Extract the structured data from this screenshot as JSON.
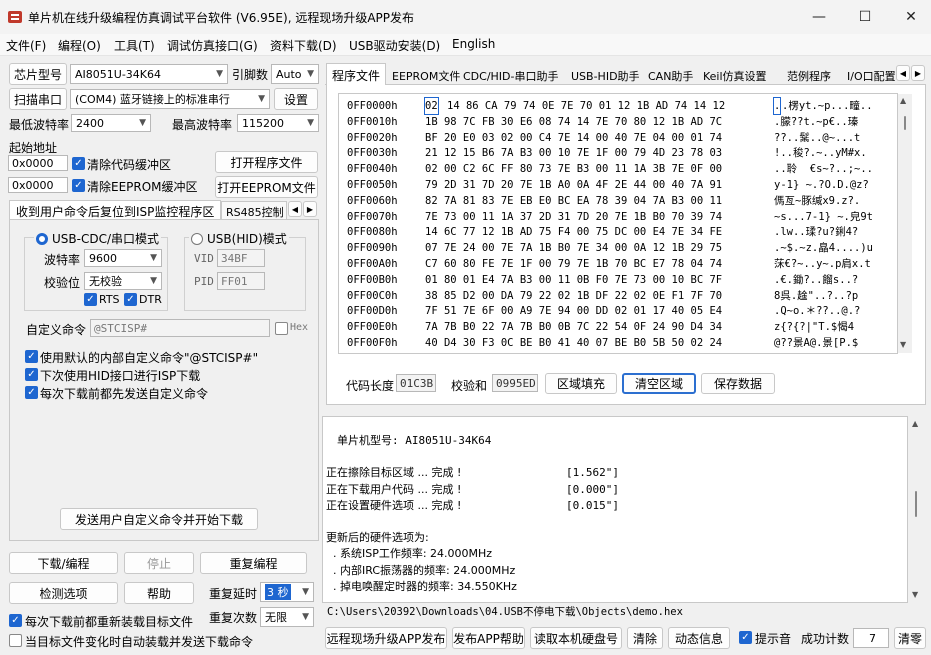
{
  "window": {
    "title": "单片机在线升级编程仿真调试平台软件 (V6.95E), 远程现场升级APP发布"
  },
  "menu": [
    "文件(F)",
    "编程(O)",
    "工具(T)",
    "调试仿真接口(G)",
    "资料下载(D)",
    "USB驱动安装(D)",
    "English"
  ],
  "left": {
    "chip_label": "芯片型号",
    "chip_value": "AI8051U-34K64",
    "pin_label": "引脚数",
    "pin_value": "Auto",
    "scan_button": "扫描串口",
    "port_value": "(COM4) 蓝牙链接上的标准串行",
    "settings_button": "设置",
    "min_baud_label": "最低波特率",
    "min_baud_value": "2400",
    "max_baud_label": "最高波特率",
    "max_baud_value": "115200",
    "start_addr_label": "起始地址",
    "addr1": "0x0000",
    "clear_code_label": "清除代码缓冲区",
    "open_prog_button": "打开程序文件",
    "addr2": "0x0000",
    "clear_eeprom_label": "清除EEPROM缓冲区",
    "open_eeprom_button": "打开EEPROM文件",
    "tab_isp": "收到用户命令后复位到ISP监控程序区",
    "tab_rs485": "RS485控制",
    "usb_cdc_label": "USB-CDC/串口模式",
    "usb_hid_label": "USB(HID)模式",
    "baud_label": "波特率",
    "baud_value": "9600",
    "parity_label": "校验位",
    "parity_value": "无校验",
    "rts_label": "RTS",
    "dtr_label": "DTR",
    "vid_label": "VID",
    "vid_value": "34BF",
    "pid_label": "PID",
    "pid_value": "FF01",
    "custom_cmd_label": "自定义命令",
    "custom_cmd_value": "@STCISP#",
    "hex_label": "Hex",
    "opt1": "使用默认的内部自定义命令\"@STCISP#\"",
    "opt2": "下次使用HID接口进行ISP下载",
    "opt3": "每次下载前都先发送自定义命令",
    "send_cmd_button": "发送用户自定义命令并开始下载",
    "download_button": "下载/编程",
    "stop_button": "停止",
    "reprogram_button": "重复编程",
    "detect_button": "检测选项",
    "help_button": "帮助",
    "repeat_delay_label": "重复延时",
    "repeat_delay_value": "3 秒",
    "repeat_count_label": "重复次数",
    "repeat_count_value": "无限",
    "reload_label": "每次下载前都重新装载目标文件",
    "auto_load_label": "当目标文件变化时自动装载并发送下载命令"
  },
  "right": {
    "tabs": [
      "程序文件",
      "EEPROM文件",
      "CDC/HID-串口助手",
      "USB-HID助手",
      "CAN助手",
      "Keil仿真设置",
      "范例程序",
      "I/O口配置"
    ],
    "hex_rows": [
      {
        "addr": "0FF0000h",
        "first": "02",
        "bytes": "14 86 CA 79 74 0E 7E 70 01 12 1B AD 74 14 12",
        "ascii_first": ".",
        "ascii": ".楞yt.~p...疃.."
      },
      {
        "addr": "0FF0010h",
        "bytes": "1B 98 7C FB 30 E6 08 74 14 7E 70 80 12 1B AD 7C",
        "ascii": ".朦??t.~p€..瑧"
      },
      {
        "addr": "0FF0020h",
        "bytes": "BF 20 E0 03 02 00 C4 7E 14 00 40 7E 04 00 01 74",
        "ascii": "??..鬗..@~...t"
      },
      {
        "addr": "0FF0030h",
        "bytes": "21 12 15 B6 7A B3 00 10 7E 1F 00 79 4D 23 78 03",
        "ascii": "!..稄?.~..yM#x."
      },
      {
        "addr": "0FF0040h",
        "bytes": "02 00 C2 6C FF 80 73 7E B3 00 11 1A 3B 7E 0F 00",
        "ascii": "..聆  €s~?..;~.."
      },
      {
        "addr": "0FF0050h",
        "bytes": "79 2D 31 7D 20 7E 1B A0 0A 4F 2E 44 00 40 7A 91",
        "ascii": "y-1} ~.?O.D.@z?"
      },
      {
        "addr": "0FF0060h",
        "bytes": "82 7A 81 83 7E EB E0 BC EA 78 39 04 7A B3 00 11",
        "ascii": "傌亙~豚缄x9.z?."
      },
      {
        "addr": "0FF0070h",
        "bytes": "7E 73 00 11 1A 37 2D 31 7D 20 7E 1B B0 70 39 74",
        "ascii": "~s...7-1} ~.皃9t"
      },
      {
        "addr": "0FF0080h",
        "bytes": "14 6C 77 12 1B AD 75 F4 00 75 DC 00 E4 7E 34 FE",
        "ascii": ".lw..瑈?u?鋓4?"
      },
      {
        "addr": "0FF0090h",
        "bytes": "07 7E 24 00 7E 7A 1B B0 7E 34 00 0A 12 1B 29 75",
        "ascii": ".~$.~z.皛4....)u"
      },
      {
        "addr": "0FF00A0h",
        "bytes": "C7 60 80 FE 7E 1F 00 79 7E 1B 70 BC E7 78 04 74",
        "ascii": "莯€?~..y~.p肩x.t"
      },
      {
        "addr": "0FF00B0h",
        "bytes": "01 80 01 E4 7A B3 00 11 0B F0 7E 73 00 10 BC 7F",
        "ascii": ".€.鋤?..餾s..?"
      },
      {
        "addr": "0FF00C0h",
        "bytes": "38 85 D2 00 DA 79 22 02 1B DF 22 02 0E F1 7F 70",
        "ascii": "8呉.趛\"..?..?p"
      },
      {
        "addr": "0FF00D0h",
        "bytes": "7F 51 7E 6F 00 A9 7E 94 00 DD 02 01 17 40 05 E4",
        "ascii": ".Q~o.＊??..@.?"
      },
      {
        "addr": "0FF00E0h",
        "bytes": "7A 7B B0 22 7A 7B B0 0B 7C 22 54 0F 24 90 D4 34",
        "ascii": "z{?{?|\"T.$愒4"
      },
      {
        "addr": "0FF00F0h",
        "bytes": "40 D4 30 F3 0C BE B0 41 40 07 BE B0 5B 50 02 24",
        "ascii": "@??景A@.景[P.$"
      }
    ],
    "code_len_label": "代码长度",
    "code_len_value": "01C3B",
    "checksum_label": "校验和",
    "checksum_value": "0995ED",
    "fill_button": "区域填充",
    "clear_button": "清空区域",
    "save_button": "保存数据",
    "log": [
      {
        "t": "单片机型号: AI8051U-34K64",
        "v": "",
        "indent": 1
      },
      {
        "t": "",
        "v": "",
        "indent": 0
      },
      {
        "t": "正在擦除目标区域 ... 完成 !",
        "v": "[1.562\"]",
        "indent": 0
      },
      {
        "t": "正在下载用户代码 ... 完成 !",
        "v": "[0.000\"]",
        "indent": 0
      },
      {
        "t": "正在设置硬件选项 ... 完成 !",
        "v": "[0.015\"]",
        "indent": 0
      },
      {
        "t": "",
        "v": "",
        "indent": 0
      },
      {
        "t": "更新后的硬件选项为:",
        "v": "",
        "indent": 0
      },
      {
        "t": "  . 系统ISP工作频率: 24.000MHz",
        "v": "",
        "indent": 0
      },
      {
        "t": "  . 内部IRC振荡器的频率: 24.000MHz",
        "v": "",
        "indent": 0
      },
      {
        "t": "  . 掉电唤醒定时器的频率: 34.550KHz",
        "v": "",
        "indent": 0
      }
    ],
    "filepath": "C:\\Users\\20392\\Downloads\\04.USB不停电下载\\Objects\\demo.hex",
    "publish_button": "远程现场升级APP发布",
    "publish_help_button": "发布APP帮助",
    "read_disk_button": "读取本机硬盘号",
    "clear_log_button": "清除",
    "dynamic_info_button": "动态信息",
    "beep_label": "提示音",
    "success_label": "成功计数",
    "success_value": "7",
    "clear_count_button": "清零"
  }
}
